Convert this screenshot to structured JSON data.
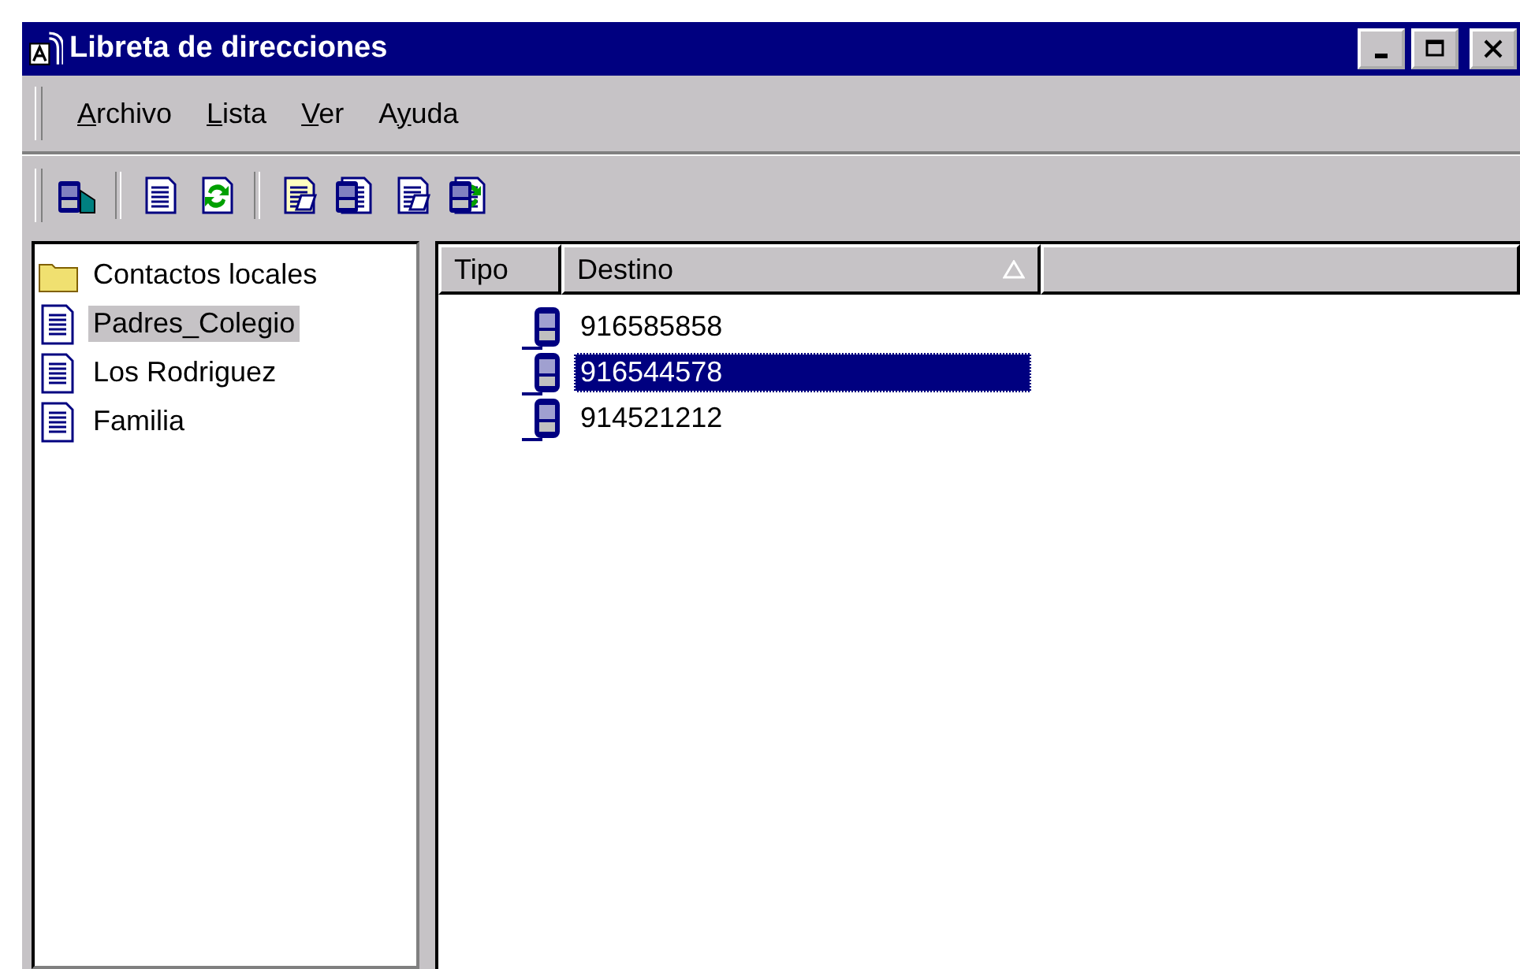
{
  "window": {
    "title": "Libreta de direcciones"
  },
  "menu": [
    {
      "key": "A",
      "after": "rchivo"
    },
    {
      "key": "L",
      "after": "ista"
    },
    {
      "key": "V",
      "after": "er"
    },
    {
      "before": "A",
      "key": "y",
      "after": "uda"
    }
  ],
  "sidebar": {
    "items": [
      {
        "label": "Contactos locales",
        "kind": "folder",
        "selected": false
      },
      {
        "label": "Padres_Colegio",
        "kind": "list",
        "selected": true
      },
      {
        "label": "Los Rodriguez",
        "kind": "list",
        "selected": false
      },
      {
        "label": "Familia",
        "kind": "list",
        "selected": false
      }
    ]
  },
  "table": {
    "columns": [
      {
        "label": "Tipo",
        "sorted_ascending": false
      },
      {
        "label": "Destino",
        "sorted_ascending": true
      }
    ],
    "rows": [
      {
        "kind": "phone",
        "destino": "916585858",
        "selected": false
      },
      {
        "kind": "phone",
        "destino": "916544578",
        "selected": true
      },
      {
        "kind": "phone",
        "destino": "914521212",
        "selected": false
      }
    ]
  }
}
